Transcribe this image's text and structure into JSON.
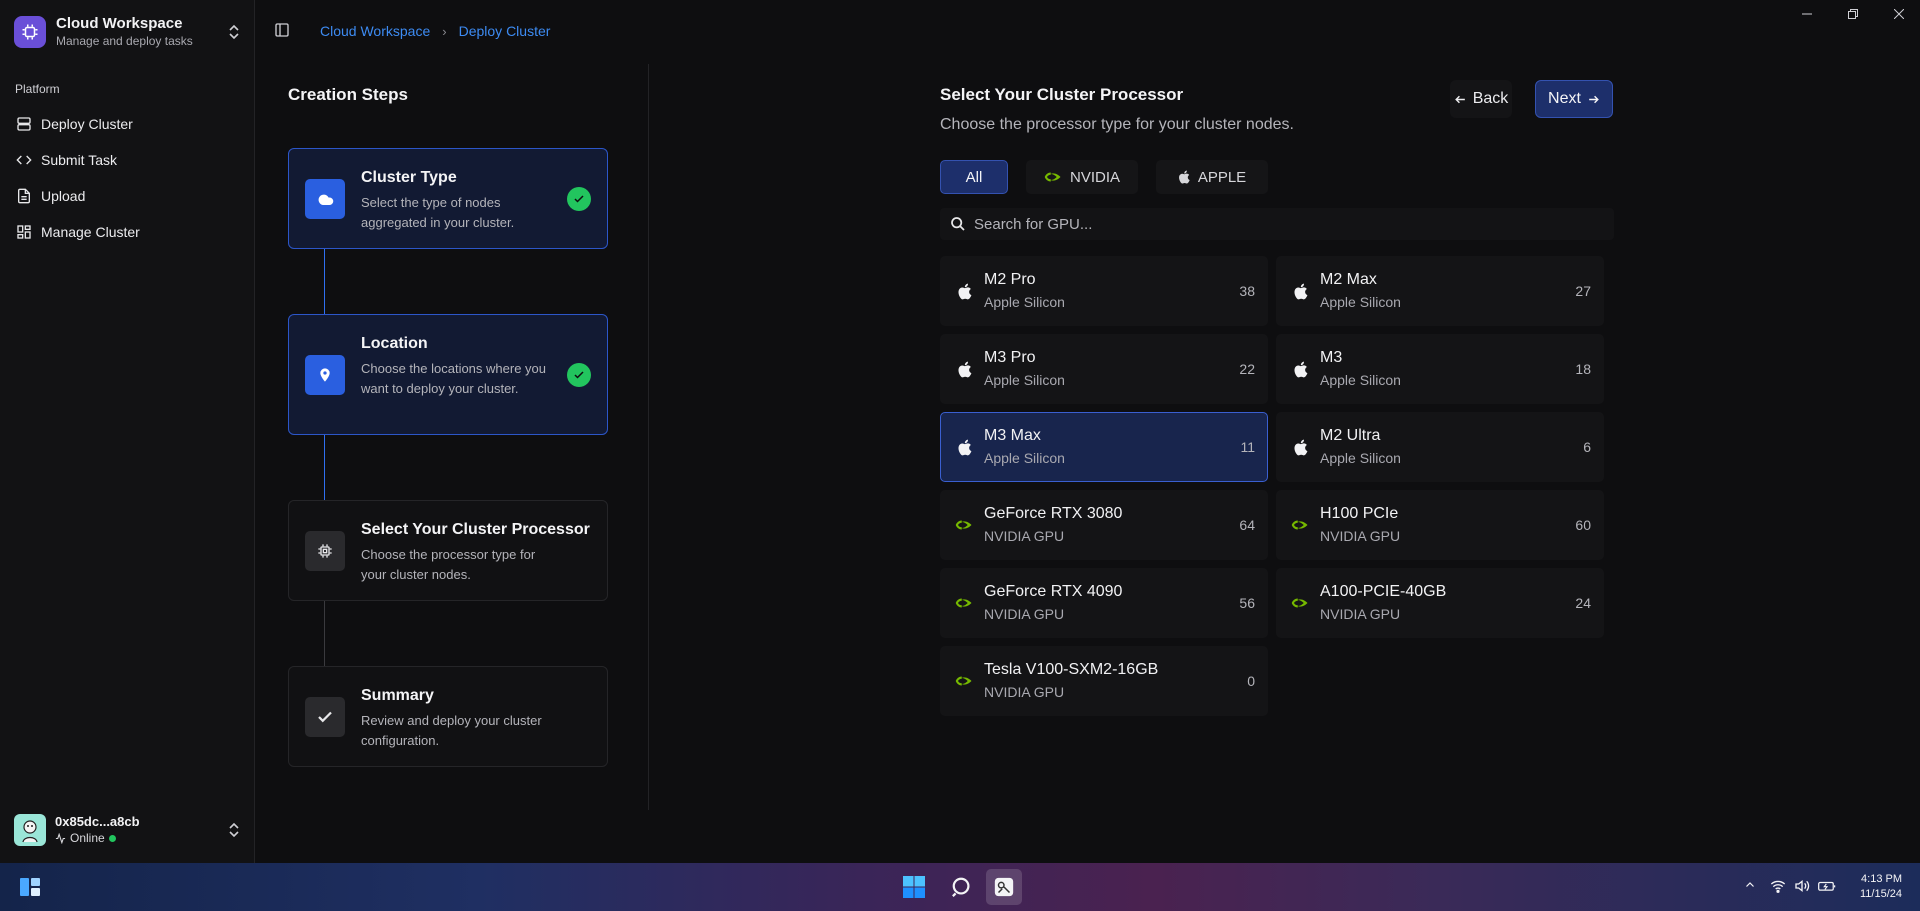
{
  "workspace": {
    "title": "Cloud Workspace",
    "subtitle": "Manage and deploy tasks"
  },
  "sidebar": {
    "section_label": "Platform",
    "items": [
      {
        "label": "Deploy Cluster",
        "icon": "server-icon"
      },
      {
        "label": "Submit Task",
        "icon": "code-icon"
      },
      {
        "label": "Upload",
        "icon": "file-icon"
      },
      {
        "label": "Manage Cluster",
        "icon": "dashboard-icon"
      }
    ]
  },
  "user": {
    "name": "0x85dc...a8cb",
    "status": "Online"
  },
  "breadcrumb": {
    "root": "Cloud Workspace",
    "current": "Deploy Cluster"
  },
  "steps": {
    "title": "Creation Steps",
    "items": [
      {
        "title": "Cluster Type",
        "desc": "Select the type of nodes aggregated in your cluster.",
        "state": "done",
        "icon": "cloud-icon"
      },
      {
        "title": "Location",
        "desc": "Choose the locations where you want to deploy your cluster.",
        "state": "done",
        "icon": "map-pin-icon"
      },
      {
        "title": "Select Your Cluster Processor",
        "desc": "Choose the processor type for your cluster nodes.",
        "state": "current",
        "icon": "cpu-icon"
      },
      {
        "title": "Summary",
        "desc": "Review and deploy your cluster configuration.",
        "state": "pending",
        "icon": "check-icon"
      }
    ]
  },
  "main": {
    "title": "Select Your Cluster Processor",
    "subtitle": "Choose the processor type for your cluster nodes.",
    "back_label": "Back",
    "next_label": "Next",
    "filters": [
      {
        "label": "All",
        "active": true
      },
      {
        "label": "NVIDIA",
        "active": false
      },
      {
        "label": "APPLE",
        "active": false
      }
    ],
    "search_placeholder": "Search for GPU...",
    "gpus": [
      {
        "name": "M2 Pro",
        "vendor": "Apple Silicon",
        "count": "38",
        "brand": "apple"
      },
      {
        "name": "M2 Max",
        "vendor": "Apple Silicon",
        "count": "27",
        "brand": "apple"
      },
      {
        "name": "M3 Pro",
        "vendor": "Apple Silicon",
        "count": "22",
        "brand": "apple"
      },
      {
        "name": "M3",
        "vendor": "Apple Silicon",
        "count": "18",
        "brand": "apple"
      },
      {
        "name": "M3 Max",
        "vendor": "Apple Silicon",
        "count": "11",
        "brand": "apple",
        "selected": true
      },
      {
        "name": "M2 Ultra",
        "vendor": "Apple Silicon",
        "count": "6",
        "brand": "apple"
      },
      {
        "name": "GeForce RTX 3080",
        "vendor": "NVIDIA GPU",
        "count": "64",
        "brand": "nvidia"
      },
      {
        "name": "H100 PCIe",
        "vendor": "NVIDIA GPU",
        "count": "60",
        "brand": "nvidia"
      },
      {
        "name": "GeForce RTX 4090",
        "vendor": "NVIDIA GPU",
        "count": "56",
        "brand": "nvidia"
      },
      {
        "name": "A100-PCIE-40GB",
        "vendor": "NVIDIA GPU",
        "count": "24",
        "brand": "nvidia"
      },
      {
        "name": "Tesla V100-SXM2-16GB",
        "vendor": "NVIDIA GPU",
        "count": "0",
        "brand": "nvidia"
      }
    ]
  },
  "taskbar": {
    "time": "4:13 PM",
    "date": "11/15/24"
  },
  "colors": {
    "accent": "#2a5fe0",
    "success": "#22c55e",
    "nvidia": "#76b900"
  }
}
